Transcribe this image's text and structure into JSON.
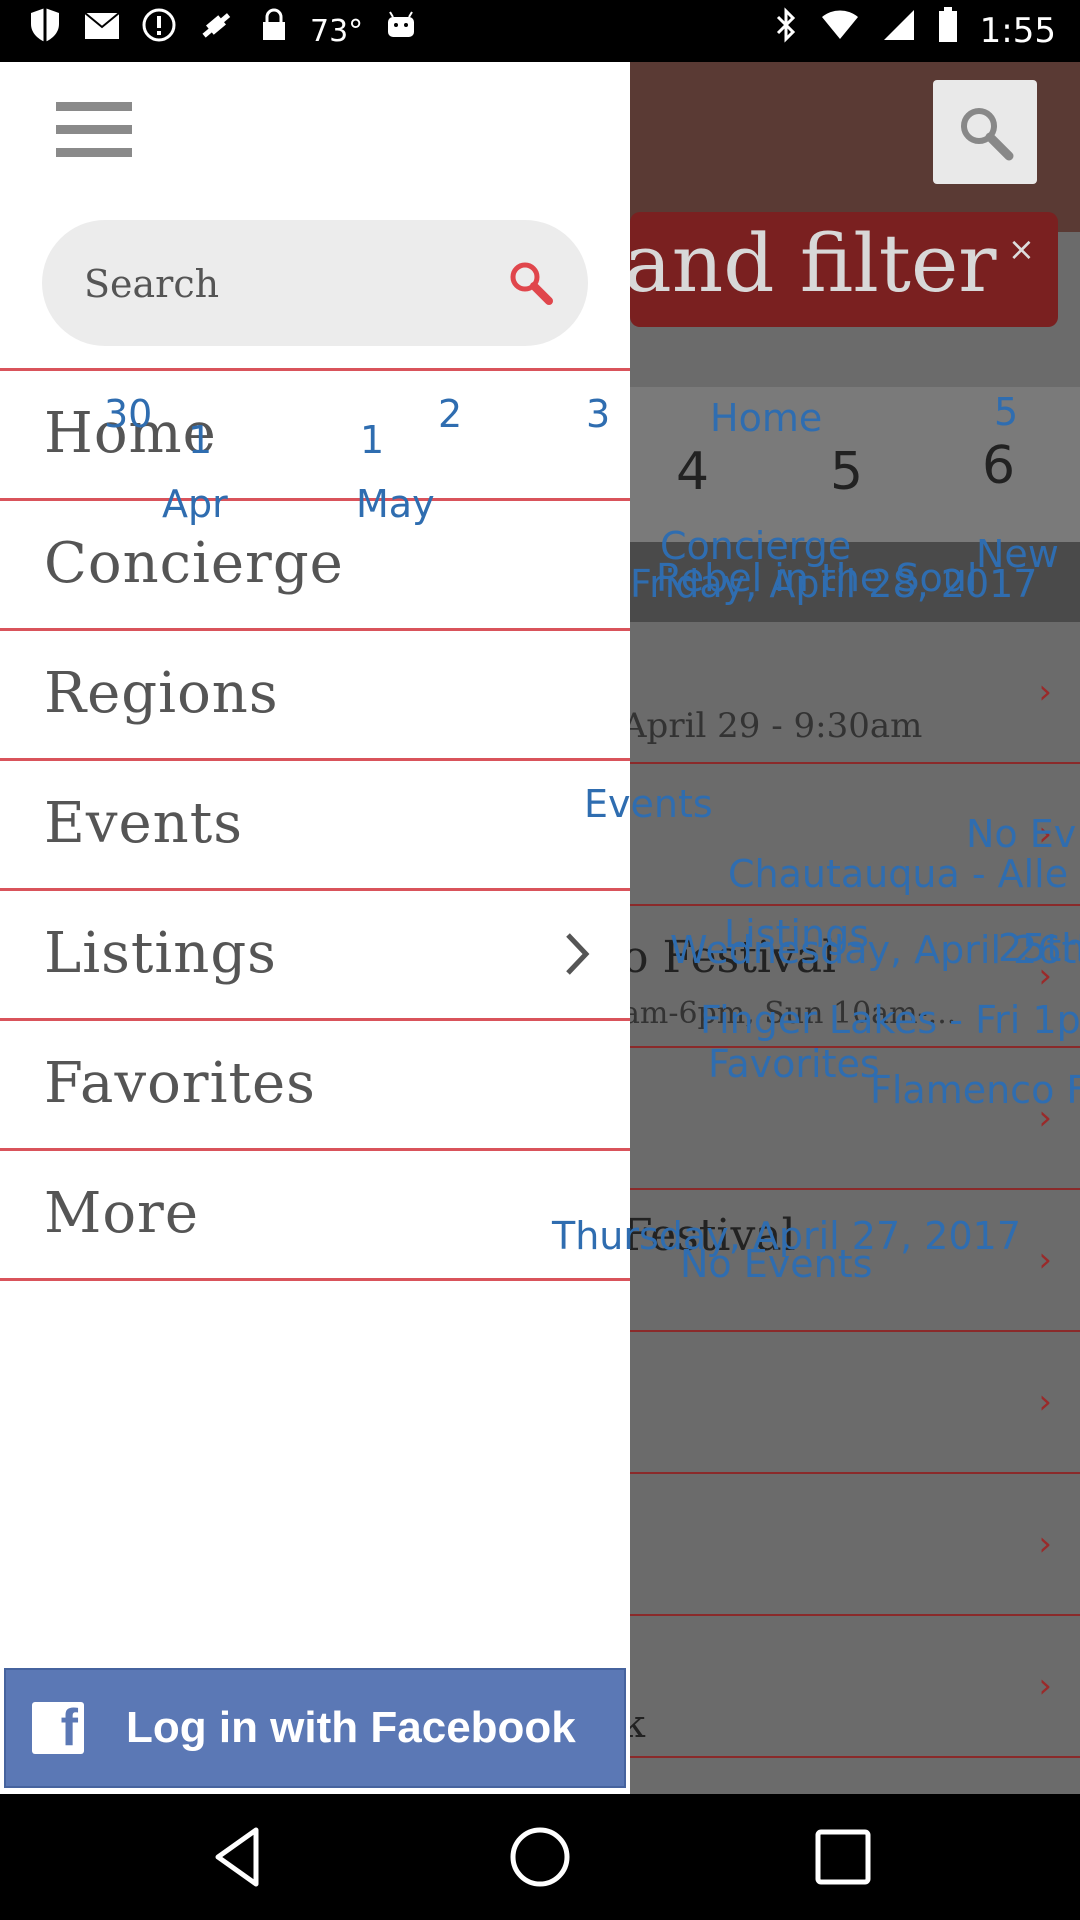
{
  "status_bar": {
    "temperature": "73°",
    "time": "1:55",
    "left_icons": [
      "shield-icon",
      "mail-icon",
      "alert-icon",
      "fake-gps-icon",
      "lock-icon",
      "android-icon"
    ],
    "right_icons": [
      "bluetooth-icon",
      "wifi-icon",
      "signal-icon",
      "battery-icon"
    ]
  },
  "drawer": {
    "search": {
      "placeholder": "Search"
    },
    "menu_items": [
      {
        "label": "Home"
      },
      {
        "label": "Concierge"
      },
      {
        "label": "Regions"
      },
      {
        "label": "Events"
      },
      {
        "label": "Listings"
      },
      {
        "label": "Favorites"
      },
      {
        "label": "More"
      }
    ],
    "facebook_button": {
      "label": "Log in with Facebook"
    }
  },
  "background": {
    "banner_text": "and filter",
    "banner_close": "×",
    "calendar_numbers": [
      "4",
      "5",
      "6"
    ],
    "row_texts": [
      "April 29 - 9:30am",
      "o Festival",
      "am-6pm, Sun 10am-...",
      "Festival",
      "k"
    ]
  },
  "overlay_labels": {
    "day_30": "30",
    "day_1": "1",
    "month_apr": "Apr",
    "day_1b": "1",
    "month_may": "May",
    "day_2": "2",
    "day_3": "3",
    "home": "Home",
    "five": "5",
    "concierge": "Concierge",
    "new": "New",
    "rebel": "Rebel in the Soul",
    "friday": "Friday, April 28, 2017",
    "events": "Events",
    "no_ev": "No Ev",
    "chautauqua": "Chautauqua - Alle",
    "listings": "Listings",
    "wednesday": "Wednesday, April 26th",
    "twenty5": "25th",
    "finger_lakes": "Finger Lakes - Fri 1p",
    "favorites": "Favorites",
    "flamenco": "Flamenco F",
    "thursday": "Thursday, April 27, 2017",
    "no_events": "No Events"
  }
}
